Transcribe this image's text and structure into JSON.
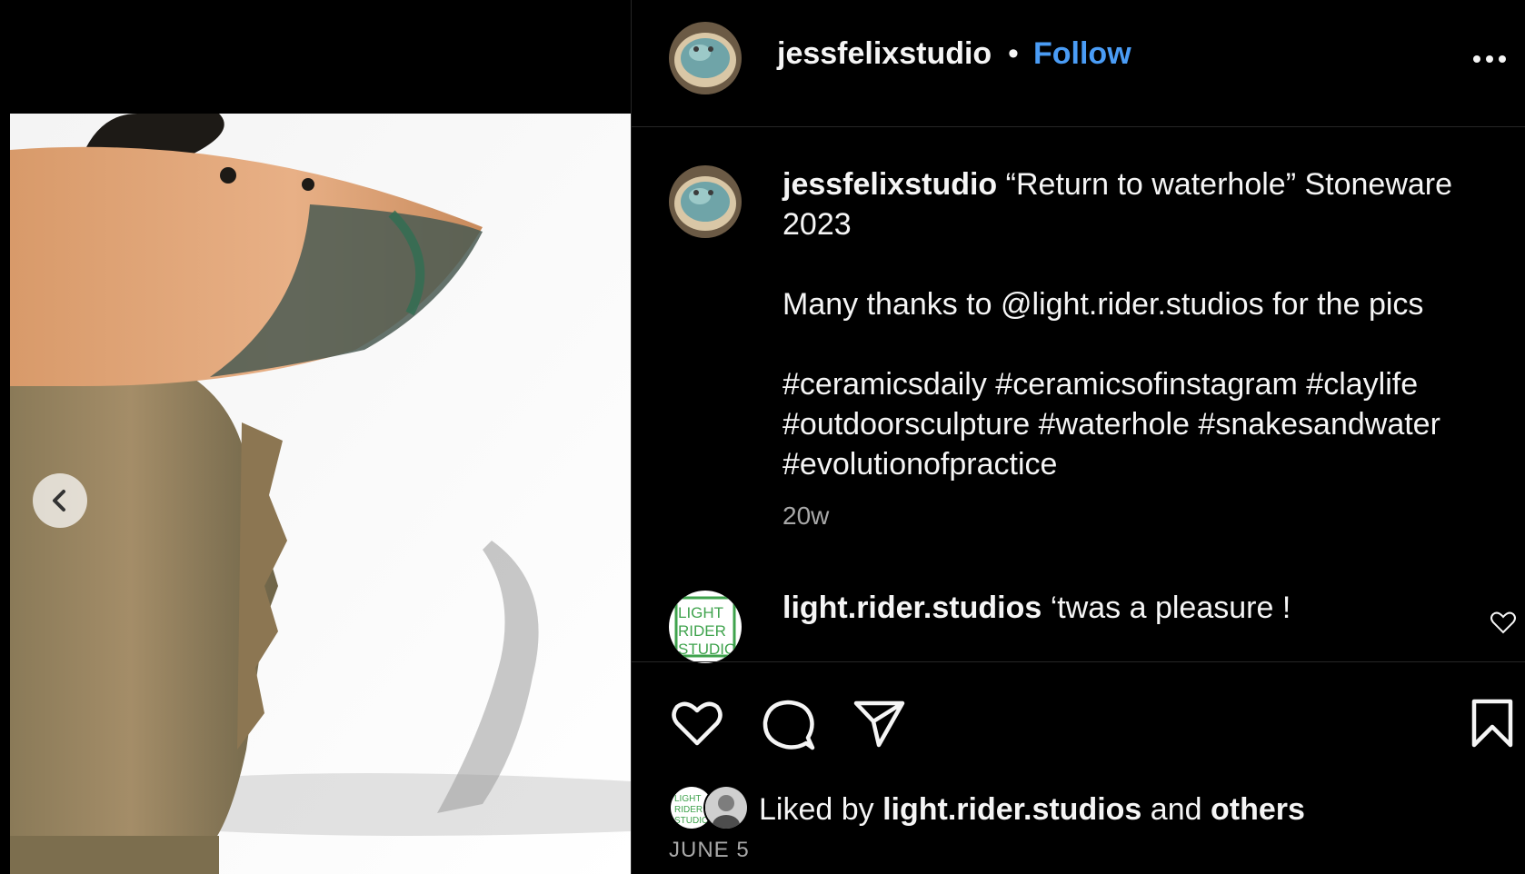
{
  "header": {
    "username": "jessfelixstudio",
    "separator": "•",
    "follow_label": "Follow",
    "more_icon": "more-horizontal-icon"
  },
  "caption": {
    "username": "jessfelixstudio",
    "line1": "“Return to waterhole” Stoneware 2023",
    "line2": "Many thanks to @light.rider.studios for the pics",
    "hashtags": "#ceramicsdaily #ceramicsofinstagram #claylife #outdoorsculpture #waterhole #snakesandwater #evolutionofpractice",
    "age": "20w"
  },
  "comment": {
    "username": "light.rider.studios",
    "text": "‘twas a pleasure !",
    "avatar_text": "LIGHT RIDER STUDIOS"
  },
  "actions": {
    "like_icon": "heart-icon",
    "comment_icon": "comment-icon",
    "share_icon": "send-icon",
    "save_icon": "bookmark-icon"
  },
  "likes": {
    "prefix": "Liked by",
    "user": "light.rider.studios",
    "conjunction": "and",
    "others": "others"
  },
  "date": "JUNE 5",
  "media": {
    "prev_icon": "chevron-left-icon"
  },
  "colors": {
    "background": "#000000",
    "link_blue": "#4a9cf5",
    "muted_text": "#a8a8a8",
    "divider": "#262626",
    "light_rider_green": "#3fa34d"
  }
}
